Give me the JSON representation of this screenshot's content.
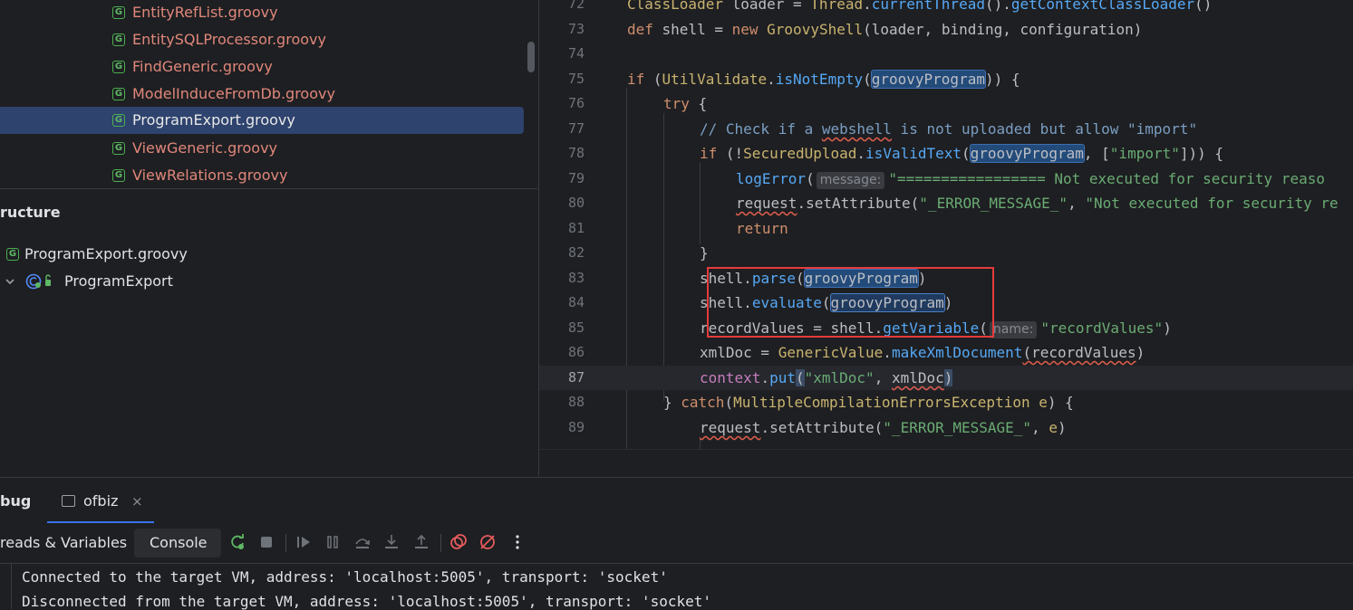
{
  "project_tree": {
    "items": [
      {
        "label": "EntityRefList.groovy",
        "selected": false
      },
      {
        "label": "EntitySQLProcessor.groovy",
        "selected": false
      },
      {
        "label": "FindGeneric.groovy",
        "selected": false
      },
      {
        "label": "ModelInduceFromDb.groovy",
        "selected": false
      },
      {
        "label": "ProgramExport.groovy",
        "selected": true
      },
      {
        "label": "ViewGeneric.groovy",
        "selected": false
      },
      {
        "label": "ViewRelations.groovy",
        "selected": false
      }
    ],
    "file_icon_letter": "G"
  },
  "structure": {
    "title": "ructure",
    "items": [
      {
        "label": "ProgramExport.groovy"
      },
      {
        "label": "ProgramExport"
      }
    ]
  },
  "editor": {
    "line_numbers": [
      "72",
      "73",
      "74",
      "75",
      "76",
      "77",
      "78",
      "79",
      "80",
      "81",
      "82",
      "83",
      "84",
      "85",
      "86",
      "87",
      "88",
      "89"
    ],
    "current_line": "87",
    "hints": {
      "message": "message:",
      "name": "name:"
    },
    "tokens": {
      "l72": [
        "ClassLoader",
        " loader = ",
        "Thread",
        ".",
        "currentThread",
        "().",
        "getContextClassLoader",
        "()"
      ],
      "l73": [
        "def",
        " shell = ",
        "new",
        " ",
        "GroovyShell",
        "(loader, binding, configuration)"
      ],
      "l75": [
        "if",
        " (",
        "UtilValidate",
        ".",
        "isNotEmpty",
        "(",
        "groovyProgram",
        ")) {"
      ],
      "l76": [
        "try",
        " {"
      ],
      "l77": [
        "// Check if a ",
        "webshell",
        " is not uploaded but allow \"import\""
      ],
      "l78": [
        "if",
        " (!",
        "SecuredUpload",
        ".",
        "isValidText",
        "(",
        "groovyProgram",
        ", [",
        "\"import\"",
        "])) {"
      ],
      "l79": [
        "logError",
        "(",
        "\"================= Not executed for security reaso"
      ],
      "l80": [
        "request",
        ".setAttribute(",
        "\"_ERROR_MESSAGE_\"",
        ", ",
        "\"Not executed for security re"
      ],
      "l81": [
        "return"
      ],
      "l82": [
        "}"
      ],
      "l83": [
        "shell",
        ".",
        "parse",
        "(",
        "groovyProgram",
        ")"
      ],
      "l84": [
        "shell",
        ".",
        "evaluate",
        "(",
        "groovyProgram",
        ")"
      ],
      "l85": [
        "recordValues",
        " = shell.",
        "getVariable",
        "(",
        "\"recordValues\"",
        ")"
      ],
      "l86": [
        "xmlDoc",
        " = ",
        "GenericValue",
        ".",
        "makeXmlDocument",
        "(",
        "recordValues",
        ")"
      ],
      "l87": [
        "context",
        ".",
        "put",
        "(",
        "\"xmlDoc\"",
        ", ",
        "xmlDoc",
        ")"
      ],
      "l88": [
        "} ",
        "catch",
        "(",
        "MultipleCompilationErrorsException",
        " ",
        "e",
        ") {"
      ],
      "l89": [
        "request",
        ".setAttribute(",
        "\"_ERROR_MESSAGE_\"",
        ", ",
        "e",
        ")"
      ]
    }
  },
  "debug": {
    "title": "bug",
    "session_tab": "ofbiz",
    "close_glyph": "×",
    "tabs": {
      "threads": "reads & Variables",
      "console": "Console"
    },
    "console_lines": [
      "Connected to the target VM, address: 'localhost:5005', transport: 'socket'",
      "Disconnected from the target VM, address: 'localhost:5005', transport: 'socket'"
    ]
  },
  "colors": {
    "selection": "#2e436e",
    "annotation_box": "#e63b3b",
    "accent": "#3574f0"
  }
}
